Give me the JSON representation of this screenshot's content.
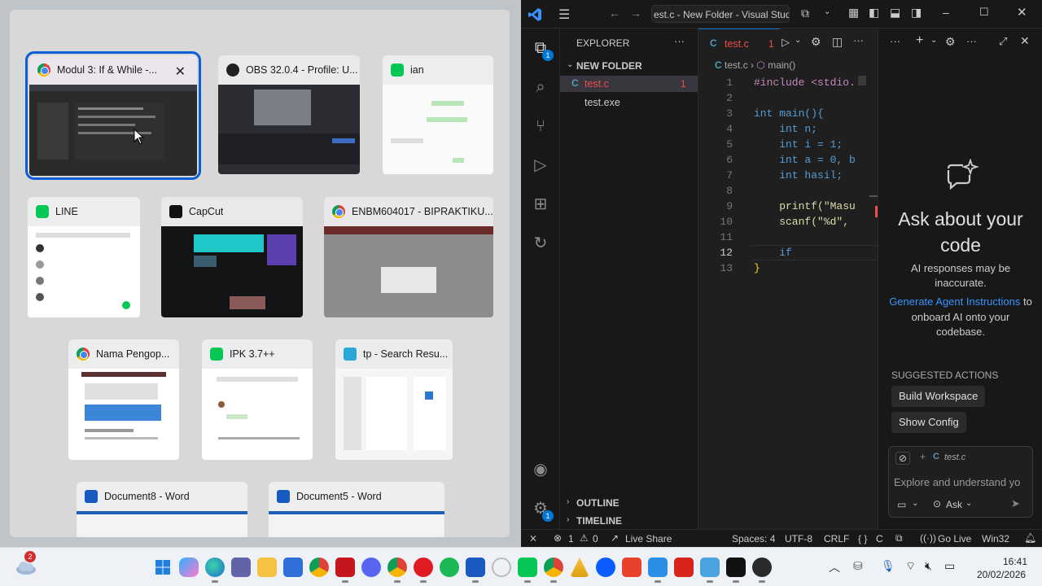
{
  "switcher": {
    "windows": [
      {
        "title": "Modul 3: If & While -...",
        "icon": "chrome-icon",
        "close": "✕"
      },
      {
        "title": "OBS 32.0.4 - Profile: U...",
        "icon": "obs-icon"
      },
      {
        "title": "ian",
        "icon": "line-icon"
      },
      {
        "title": "LINE",
        "icon": "line-icon"
      },
      {
        "title": "CapCut",
        "icon": "capcut-icon"
      },
      {
        "title": "ENBM604017 - BIPRAKTIKU...",
        "icon": "chrome-icon"
      },
      {
        "title": "Nama Pengop...",
        "icon": "chrome-icon"
      },
      {
        "title": "IPK 3.7++",
        "icon": "line-icon"
      },
      {
        "title": "tp - Search Resu...",
        "icon": "search-icon"
      },
      {
        "title": "Document8 - Word",
        "icon": "word-icon"
      },
      {
        "title": "Document5 - Word",
        "icon": "word-icon"
      }
    ]
  },
  "vscode": {
    "title": "est.c - New Folder - Visual Studi",
    "explorer": {
      "header": "EXPLORER",
      "folder": "NEW FOLDER",
      "files": [
        {
          "name": "test.c",
          "badge": "1",
          "lang": "C"
        },
        {
          "name": "test.exe"
        }
      ],
      "outline": "OUTLINE",
      "timeline": "TIMELINE"
    },
    "tab": {
      "name": "test.c",
      "lang": "C",
      "badge": "1"
    },
    "breadcrumb": {
      "file": "test.c",
      "symbol": "main()"
    },
    "code": [
      {
        "n": "1",
        "text": "#include <stdio."
      },
      {
        "n": "2",
        "text": ""
      },
      {
        "n": "3",
        "text": "int main(){"
      },
      {
        "n": "4",
        "text": "    int n;"
      },
      {
        "n": "5",
        "text": "    int i = 1;"
      },
      {
        "n": "6",
        "text": "    int a = 0, b"
      },
      {
        "n": "7",
        "text": "    int hasil;"
      },
      {
        "n": "8",
        "text": ""
      },
      {
        "n": "9",
        "text": "    printf(\"Masu"
      },
      {
        "n": "10",
        "text": "    scanf(\"%d\","
      },
      {
        "n": "11",
        "text": ""
      },
      {
        "n": "12",
        "text": "    if"
      },
      {
        "n": "13",
        "text": "}"
      }
    ],
    "chat": {
      "heading": "Ask about your code",
      "disclaimer": "AI responses may be inaccurate.",
      "link": "Generate Agent Instructions",
      "link_rest": "to onboard AI onto your codebase.",
      "suggested": "SUGGESTED ACTIONS",
      "actions": [
        "Build Workspace",
        "Show Config"
      ],
      "context_file": "test.c",
      "input_placeholder": "Explore and understand yo",
      "mode": "Ask"
    },
    "status": {
      "errors": "1",
      "warnings": "0",
      "live_share": "Live Share",
      "spaces": "Spaces: 4",
      "encoding": "UTF-8",
      "eol": "CRLF",
      "lang": "C",
      "go_live": "Go Live",
      "platform": "Win32"
    },
    "activity_badges": [
      "1",
      "1"
    ]
  },
  "taskbar": {
    "weather_badge": "2",
    "time": "16:41",
    "date": "20/02/2026"
  },
  "colors": {
    "accent": "#0a5fd6",
    "vscode_blue": "#3794ff",
    "error": "#f14c4c"
  }
}
